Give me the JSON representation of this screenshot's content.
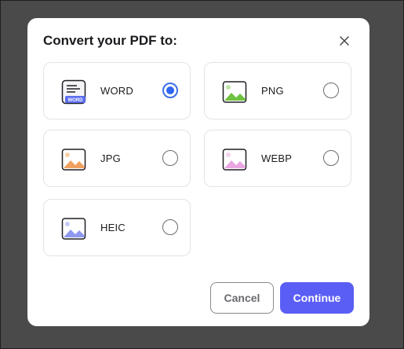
{
  "dialog": {
    "title": "Convert your PDF to:",
    "options": [
      {
        "id": "word",
        "label": "WORD",
        "badge": "WORD",
        "selected": true
      },
      {
        "id": "png",
        "label": "PNG",
        "selected": false
      },
      {
        "id": "jpg",
        "label": "JPG",
        "selected": false
      },
      {
        "id": "webp",
        "label": "WEBP",
        "selected": false
      },
      {
        "id": "heic",
        "label": "HEIC",
        "selected": false
      }
    ],
    "cancel_label": "Cancel",
    "continue_label": "Continue"
  },
  "colors": {
    "overlay": "#4a4a4a",
    "accent": "#5b5ef5",
    "radio_selected": "#2f66f0"
  },
  "icons": {
    "close": "close-icon",
    "word": "word-document-icon",
    "png": "png-image-icon",
    "jpg": "jpg-image-icon",
    "webp": "webp-image-icon",
    "heic": "heic-image-icon"
  }
}
